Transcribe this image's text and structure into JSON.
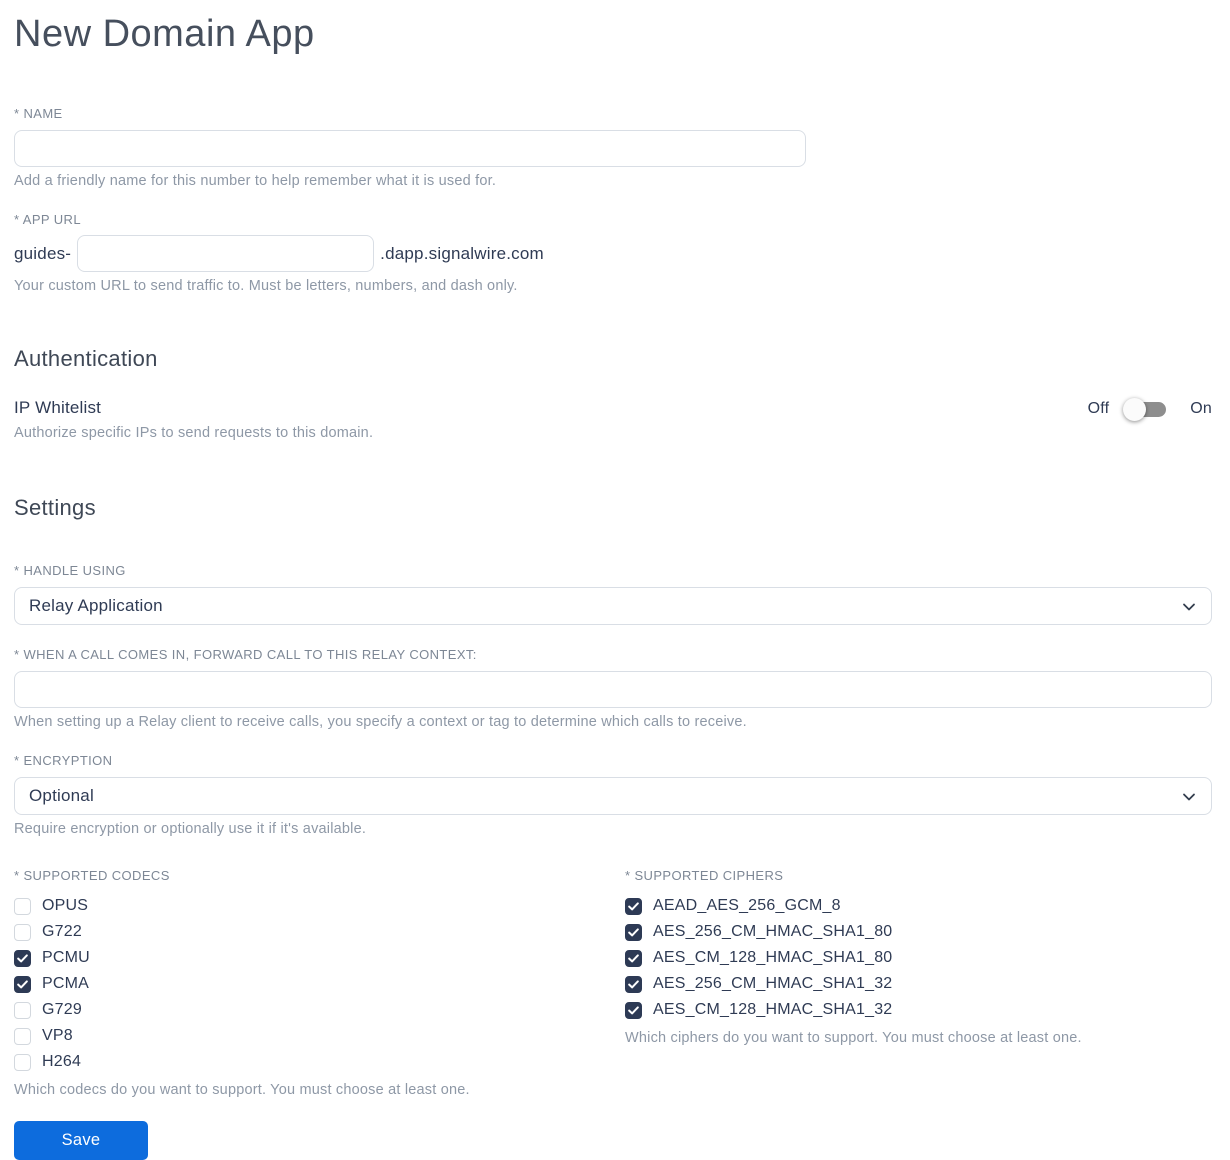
{
  "page": {
    "title": "New Domain App"
  },
  "form": {
    "name": {
      "label": "* NAME",
      "value": "",
      "helper": "Add a friendly name for this number to help remember what it is used for."
    },
    "app_url": {
      "label": "* APP URL",
      "prefix": "guides-",
      "value": "",
      "suffix": ".dapp.signalwire.com",
      "helper": "Your custom URL to send traffic to. Must be letters, numbers, and dash only."
    },
    "authentication": {
      "heading": "Authentication",
      "ip_whitelist": {
        "label": "IP Whitelist",
        "helper": "Authorize specific IPs to send requests to this domain.",
        "off_label": "Off",
        "on_label": "On",
        "state": "off"
      }
    },
    "settings": {
      "heading": "Settings",
      "handle_using": {
        "label": "* HANDLE USING",
        "value": "Relay Application"
      },
      "relay_context": {
        "label": "* WHEN A CALL COMES IN, FORWARD CALL TO THIS RELAY CONTEXT:",
        "value": "",
        "helper": "When setting up a Relay client to receive calls, you specify a context or tag to determine which calls to receive."
      },
      "encryption": {
        "label": "* ENCRYPTION",
        "value": "Optional",
        "helper": "Require encryption or optionally use it if it's available."
      },
      "codecs": {
        "label": "* SUPPORTED CODECS",
        "options": [
          {
            "label": "OPUS",
            "checked": false
          },
          {
            "label": "G722",
            "checked": false
          },
          {
            "label": "PCMU",
            "checked": true
          },
          {
            "label": "PCMA",
            "checked": true
          },
          {
            "label": "G729",
            "checked": false
          },
          {
            "label": "VP8",
            "checked": false
          },
          {
            "label": "H264",
            "checked": false
          }
        ],
        "helper": "Which codecs do you want to support. You must choose at least one."
      },
      "ciphers": {
        "label": "* SUPPORTED CIPHERS",
        "options": [
          {
            "label": "AEAD_AES_256_GCM_8",
            "checked": true
          },
          {
            "label": "AES_256_CM_HMAC_SHA1_80",
            "checked": true
          },
          {
            "label": "AES_CM_128_HMAC_SHA1_80",
            "checked": true
          },
          {
            "label": "AES_256_CM_HMAC_SHA1_32",
            "checked": true
          },
          {
            "label": "AES_CM_128_HMAC_SHA1_32",
            "checked": true
          }
        ],
        "helper": "Which ciphers do you want to support. You must choose at least one."
      }
    },
    "save_label": "Save"
  },
  "colors": {
    "accent_blue": "#0d6cdd",
    "checkbox_checked": "#2d3a55",
    "input_border": "#d9dee5",
    "label_gray": "#7d8795",
    "helper_gray": "#8e98a6",
    "text_dark": "#2f3b54",
    "toggle_track": "#8e8e8e"
  }
}
